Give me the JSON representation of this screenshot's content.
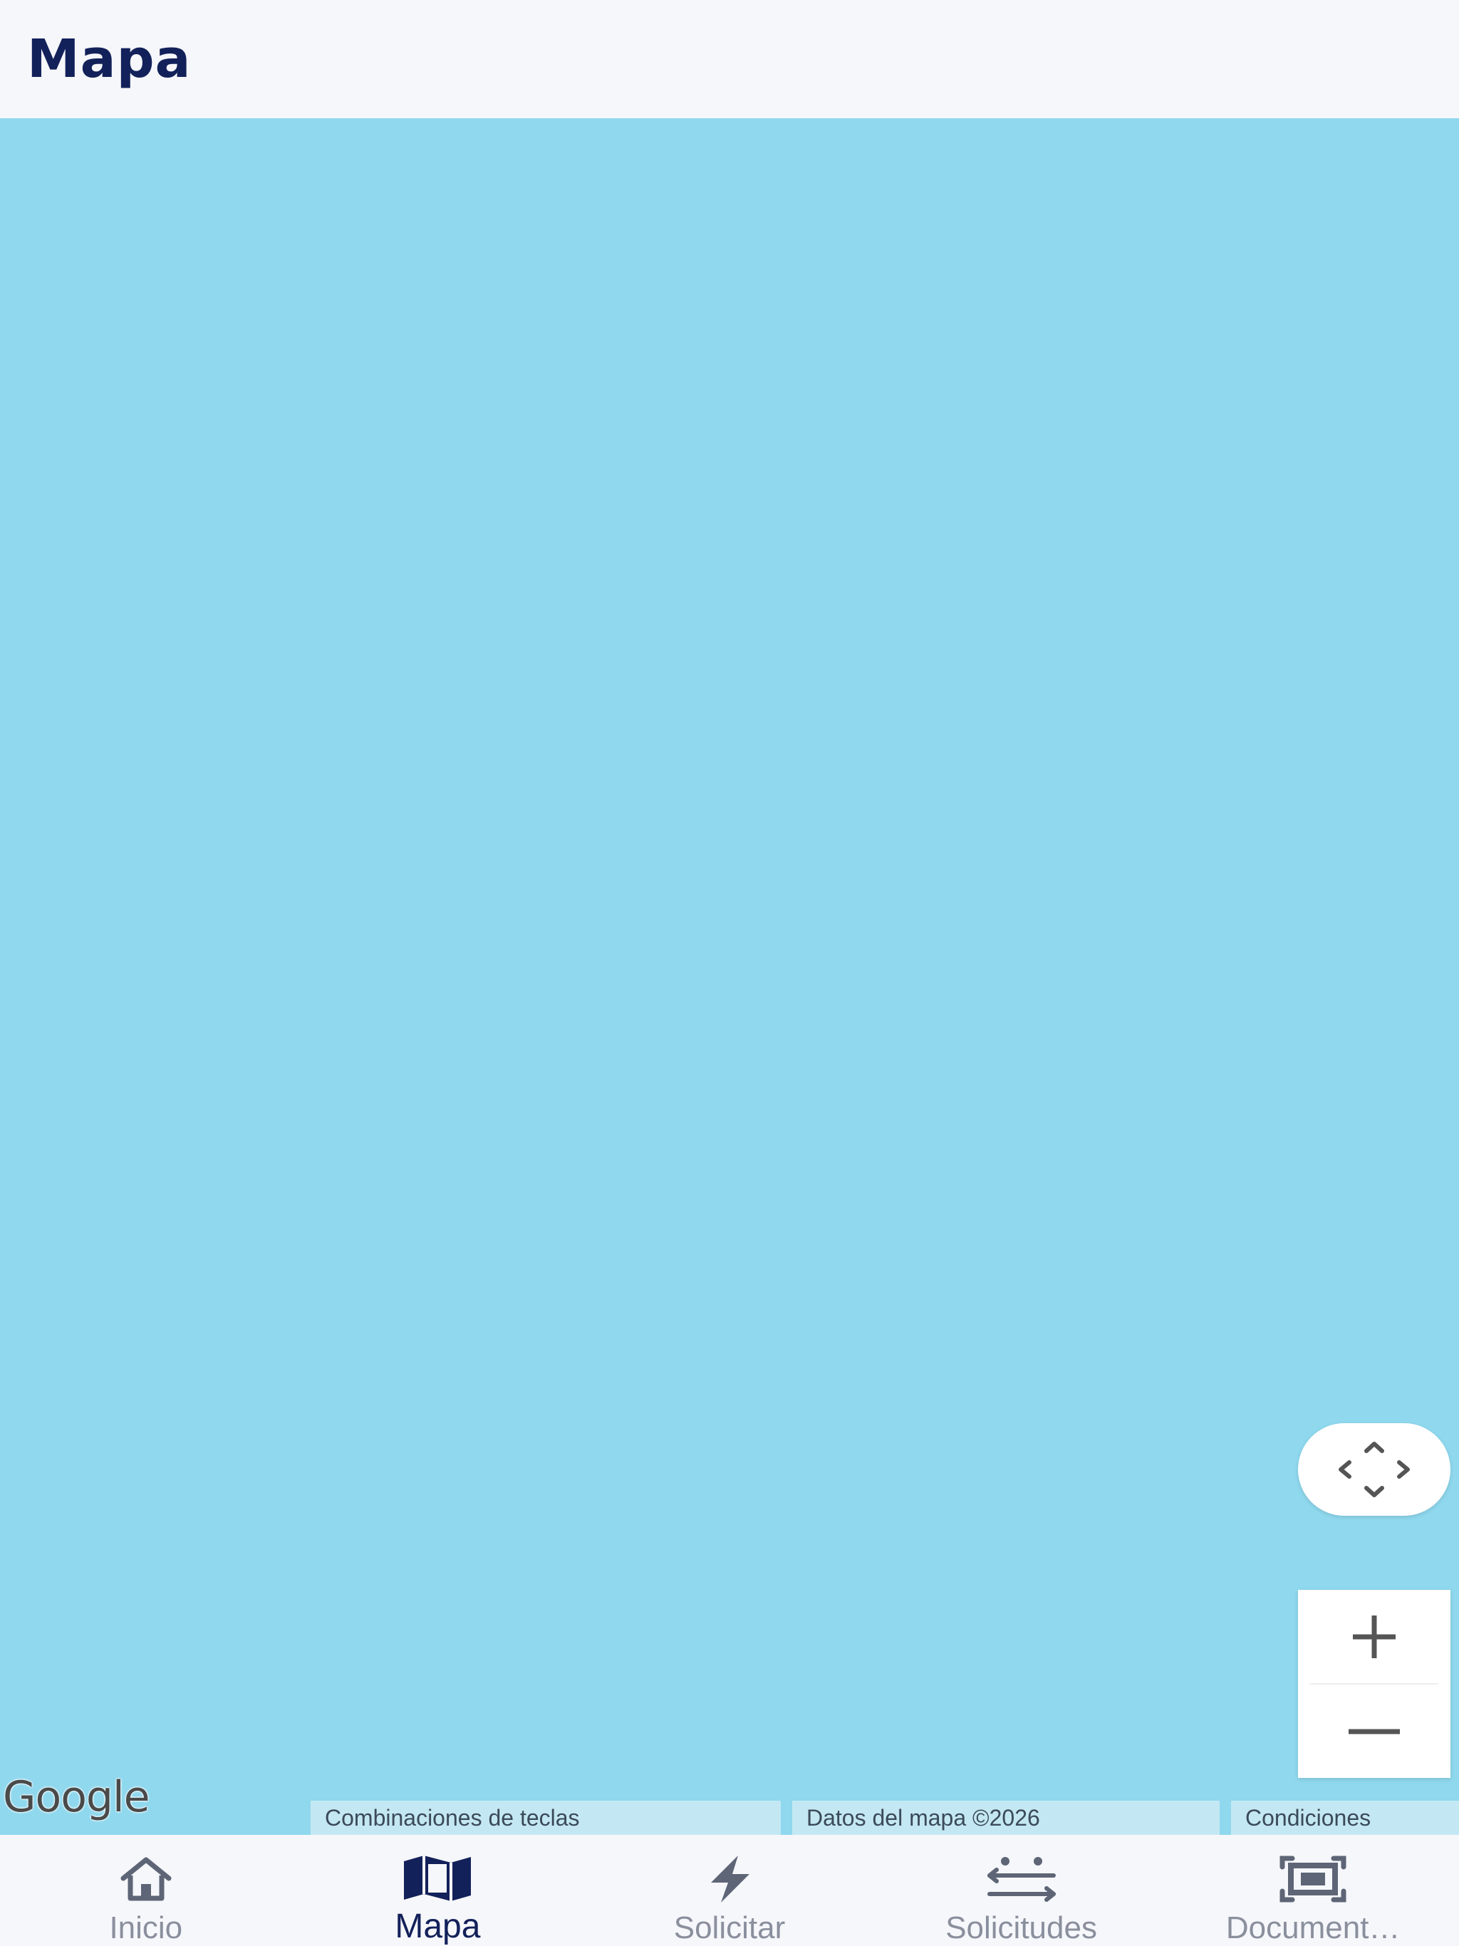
{
  "header": {
    "title": "Mapa"
  },
  "map": {
    "water_color": "#8fd8ee",
    "google_logo_text": "Google",
    "attribution": {
      "shortcuts": "Combinaciones de teclas",
      "map_data": "Datos del mapa ©2026",
      "terms": "Condiciones"
    },
    "controls": {
      "pan_icon": "pan-arrows-icon",
      "zoom_in_icon": "plus-icon",
      "zoom_out_icon": "minus-icon"
    }
  },
  "nav": {
    "accent_color": "#13215a",
    "inactive_color": "#8a8f9d",
    "items": [
      {
        "label": "Inicio",
        "icon": "home-icon",
        "active": false
      },
      {
        "label": "Mapa",
        "icon": "map-icon",
        "active": true
      },
      {
        "label": "Solicitar",
        "icon": "bolt-icon",
        "active": false
      },
      {
        "label": "Solicitudes",
        "icon": "transfer-icon",
        "active": false
      },
      {
        "label": "Document…",
        "icon": "document-frame-icon",
        "active": false
      }
    ]
  }
}
